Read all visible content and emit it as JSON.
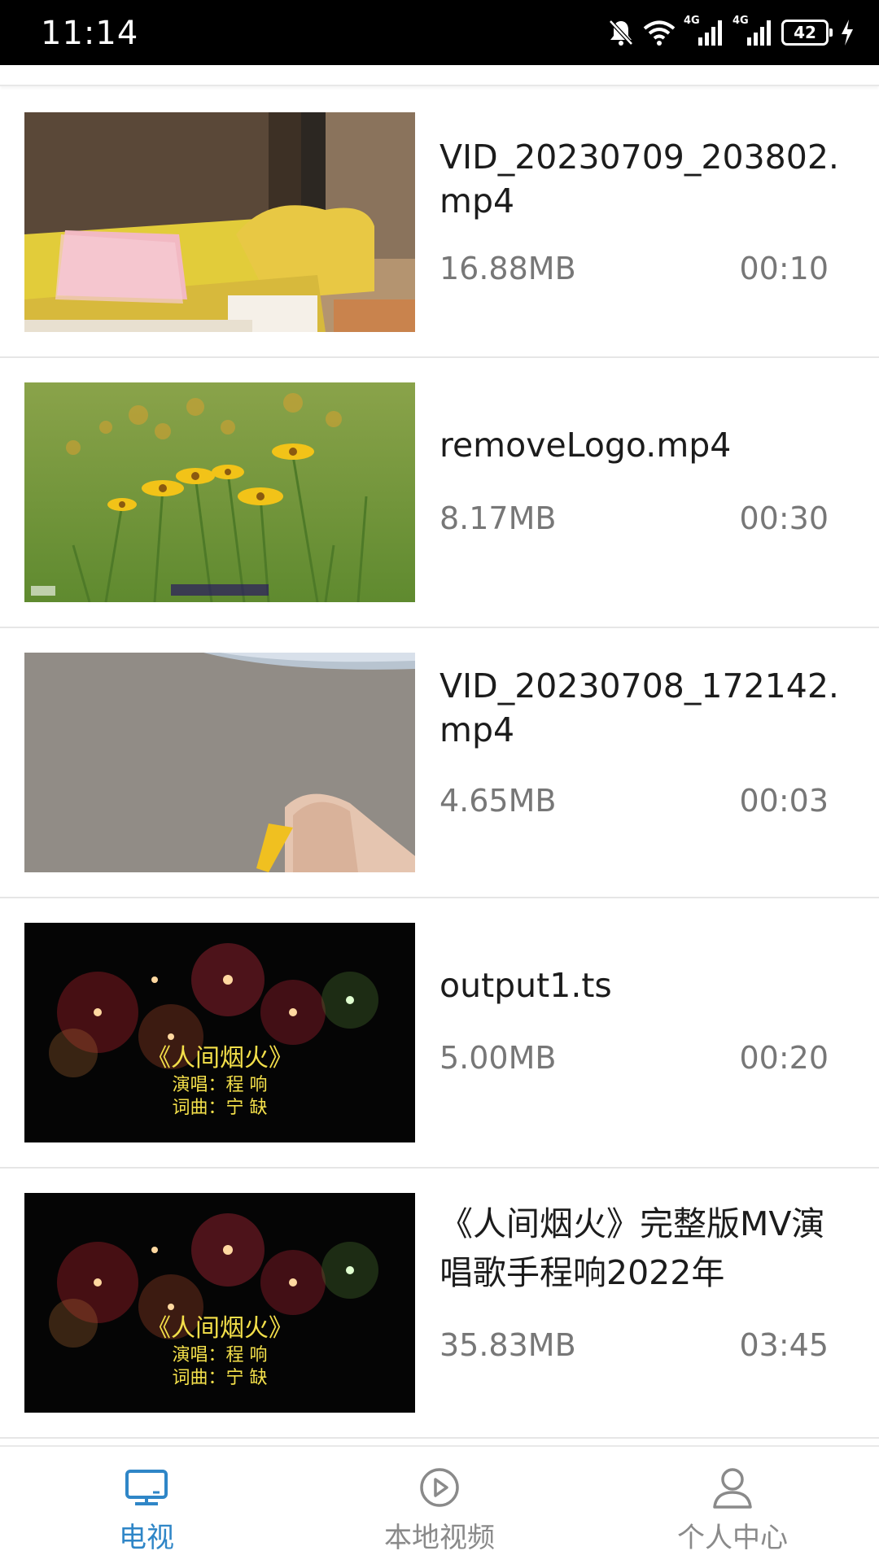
{
  "status_bar": {
    "time": "11:14",
    "battery": "42",
    "network_label_1": "4G",
    "network_label_2": "4G",
    "icons": [
      "mute-bell-icon",
      "wifi-icon",
      "signal-4g-icon",
      "signal-4g-icon",
      "battery-icon",
      "charging-icon"
    ]
  },
  "videos": [
    {
      "title": "VID_20230709_203802.mp4",
      "size": "16.88MB",
      "duration": "00:10",
      "thumbnail": "desk-books-scene"
    },
    {
      "title": "removeLogo.mp4",
      "size": "8.17MB",
      "duration": "00:30",
      "thumbnail": "yellow-flowers-scene"
    },
    {
      "title": "VID_20230708_172142.mp4",
      "size": "4.65MB",
      "duration": "00:03",
      "thumbnail": "carpet-hand-scene"
    },
    {
      "title": "output1.ts",
      "size": "5.00MB",
      "duration": "00:20",
      "thumbnail": "fireworks-scene",
      "overlay": {
        "line1": "《人间烟火》",
        "line2": "演唱：程 响",
        "line3": "词曲：宁 缺"
      }
    },
    {
      "title": "《人间烟火》完整版MV演唱歌手程响2022年",
      "size": "35.83MB",
      "duration": "03:45",
      "thumbnail": "fireworks-scene",
      "overlay": {
        "line1": "《人间烟火》",
        "line2": "演唱：程 响",
        "line3": "词曲：宁 缺"
      }
    }
  ],
  "bottom_nav": {
    "items": [
      {
        "label": "电视",
        "icon": "tv-icon",
        "active": true
      },
      {
        "label": "本地视频",
        "icon": "play-circle-icon",
        "active": false
      },
      {
        "label": "个人中心",
        "icon": "person-icon",
        "active": false
      }
    ]
  },
  "colors": {
    "accent": "#2f86c7",
    "inactive": "#8a8a8a",
    "title_text": "#1c1c1c",
    "meta_text": "#777777"
  }
}
